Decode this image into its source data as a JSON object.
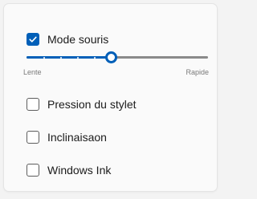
{
  "mouse_mode": {
    "label": "Mode souris",
    "checked": true
  },
  "speed_slider": {
    "min_label": "Lente",
    "max_label": "Rapide",
    "value": 0.5,
    "ticks": 5
  },
  "options": [
    {
      "label": "Pression du stylet",
      "checked": false
    },
    {
      "label": "Inclinaisaon",
      "checked": false
    },
    {
      "label": "Windows Ink",
      "checked": false
    }
  ],
  "colors": {
    "accent": "#005fb8",
    "track": "#8a8a8a",
    "text": "#1b1b1b"
  }
}
